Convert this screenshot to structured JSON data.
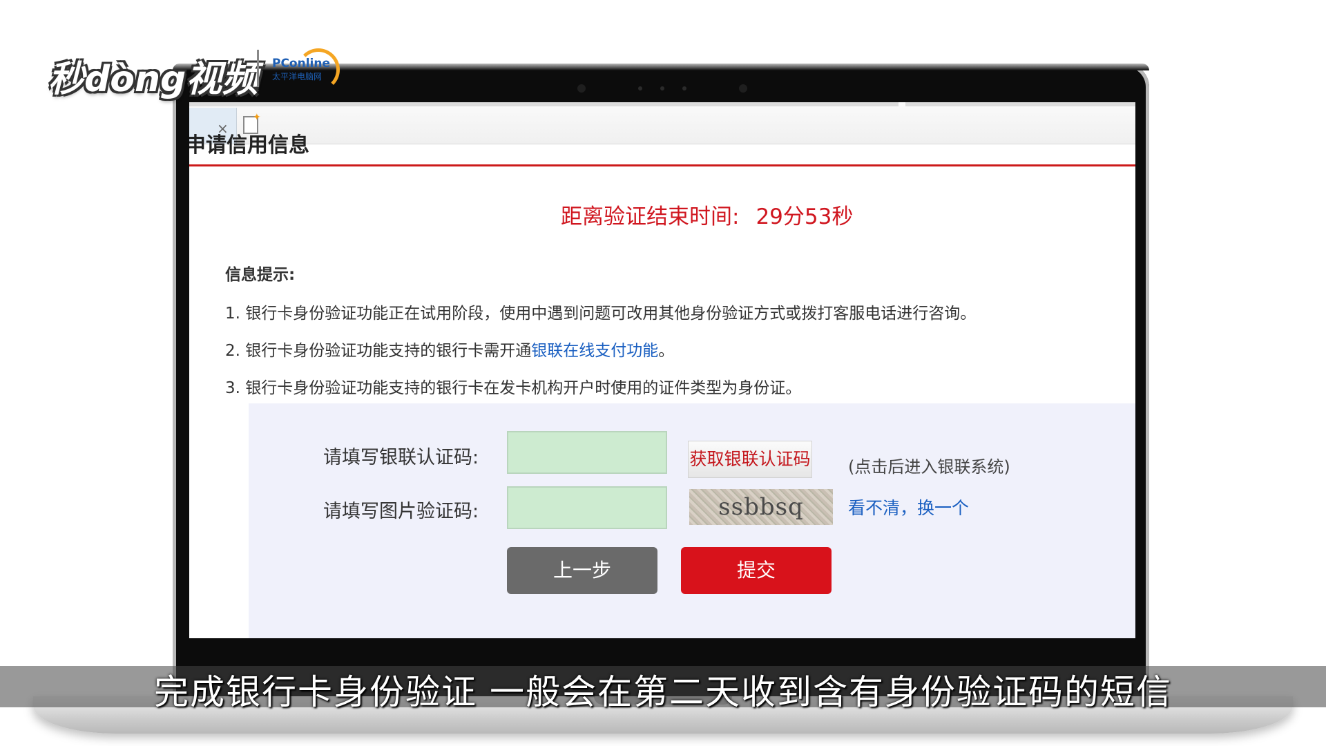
{
  "watermark": {
    "brand_text": "秒dòng视频",
    "partner_text": "PConline",
    "partner_sub": "太平洋电脑网"
  },
  "browser": {
    "tab_close": "×"
  },
  "page": {
    "heading": "申请信用信息",
    "countdown_label": "距离验证结束时间:",
    "countdown_value": "29分53秒"
  },
  "info": {
    "title": "信息提示:",
    "line1": "1. 银行卡身份验证功能正在试用阶段，使用中遇到问题可改用其他身份验证方式或拨打客服电话进行咨询。",
    "line2_prefix": "2. 银行卡身份验证功能支持的银行卡需开通",
    "line2_link": "银联在线支付功能",
    "line2_suffix": "。",
    "line3": "3. 银行卡身份验证功能支持的银行卡在发卡机构开户时使用的证件类型为身份证。"
  },
  "form": {
    "unionpay_label": "请填写银联认证码:",
    "unionpay_value": "",
    "get_code_button": "获取银联认证码",
    "get_code_hint": "(点击后进入银联系统)",
    "captcha_label": "请填写图片验证码:",
    "captcha_value": "",
    "captcha_text": "ssbbsq",
    "refresh_link": "看不清，换一个",
    "prev_button": "上一步",
    "submit_button": "提交"
  },
  "subtitle": {
    "text": "完成银行卡身份验证 一般会在第二天收到含有身份验证码的短信"
  },
  "colors": {
    "accent_red": "#d8121b",
    "link_blue": "#1a5fc1",
    "input_green": "#cdebd0"
  }
}
